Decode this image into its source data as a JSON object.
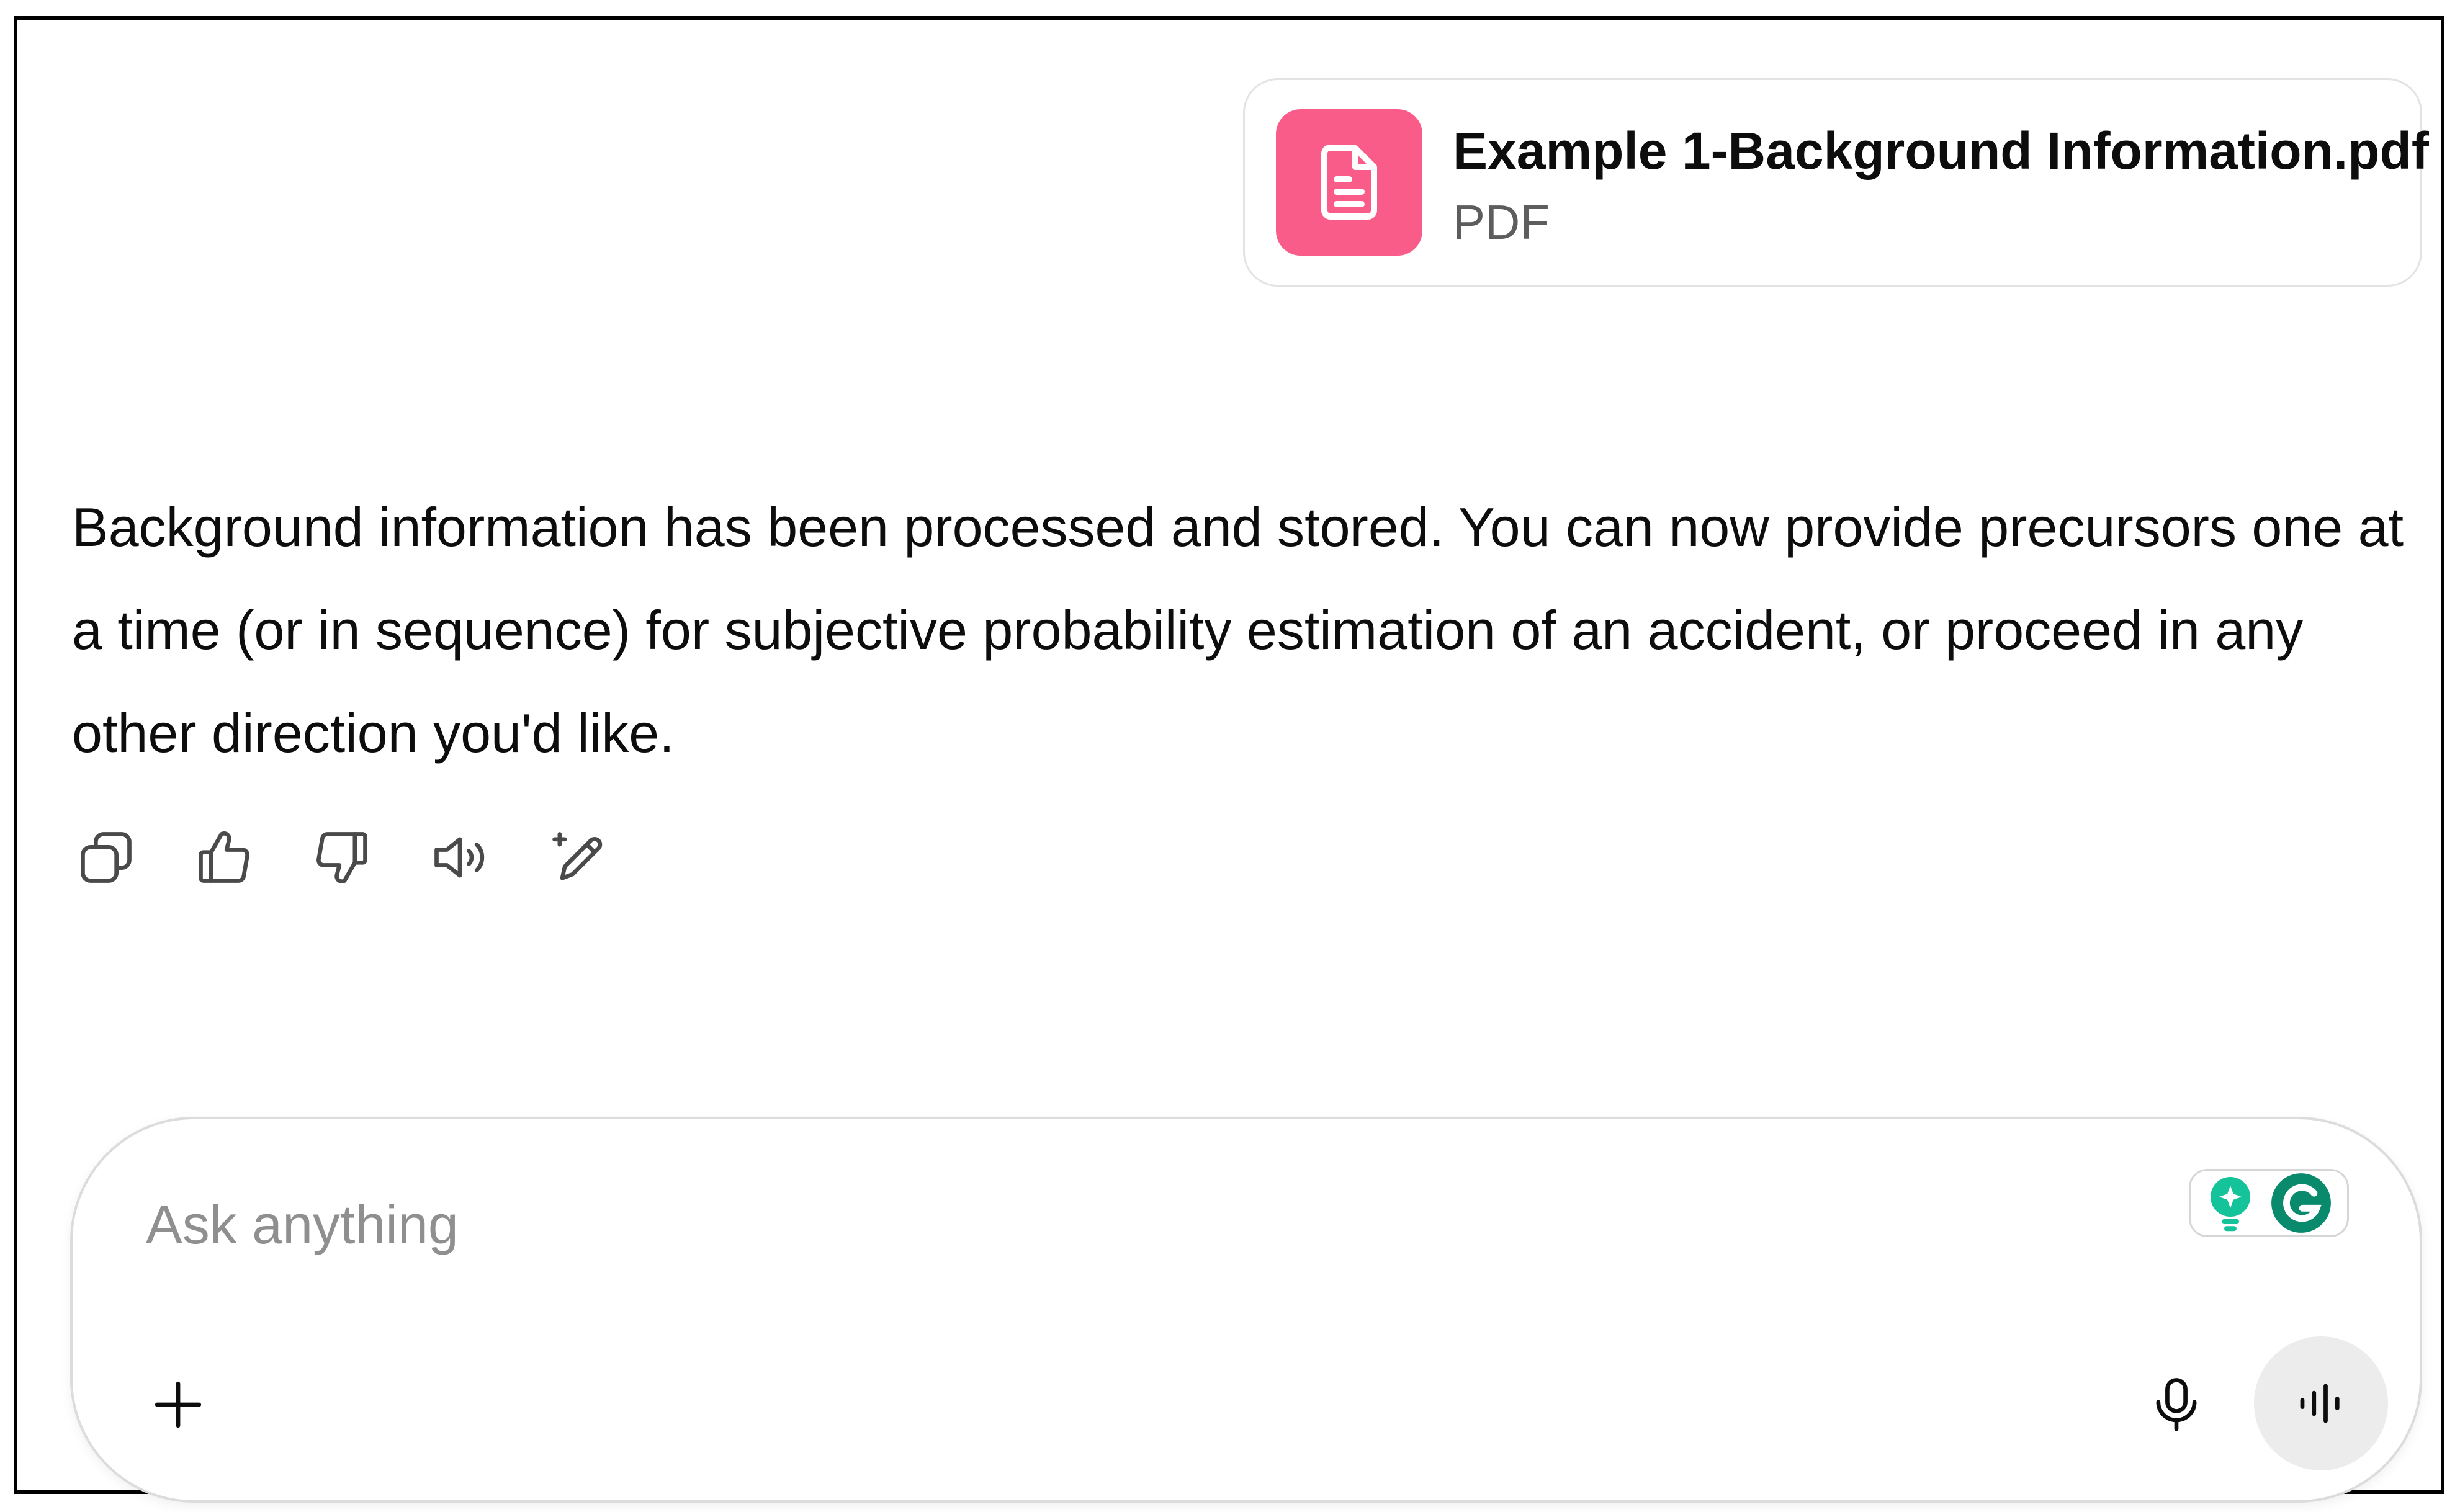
{
  "attachment": {
    "file_name": "Example 1-Background Information.pdf",
    "file_type": "PDF",
    "icon": "document-icon",
    "icon_color": "#fa5c89"
  },
  "assistant_message": {
    "text": "Background information has been processed and stored. You can now provide precursors one at a time (or in sequence) for subjective probability estimation of an accident, or proceed in any other direction you'd like."
  },
  "message_actions": [
    {
      "icon": "copy-icon"
    },
    {
      "icon": "thumbs-up-icon"
    },
    {
      "icon": "thumbs-down-icon"
    },
    {
      "icon": "read-aloud-icon"
    },
    {
      "icon": "edit-sparkle-icon"
    }
  ],
  "composer": {
    "placeholder": "Ask anything",
    "value": "",
    "add_icon": "plus-icon",
    "mic_icon": "microphone-icon",
    "voice_icon": "voice-mode-icon",
    "extension_icons": [
      "grammarly-lightbulb-icon",
      "grammarly-logo-icon"
    ],
    "grammarly_color": "#15c39a"
  }
}
